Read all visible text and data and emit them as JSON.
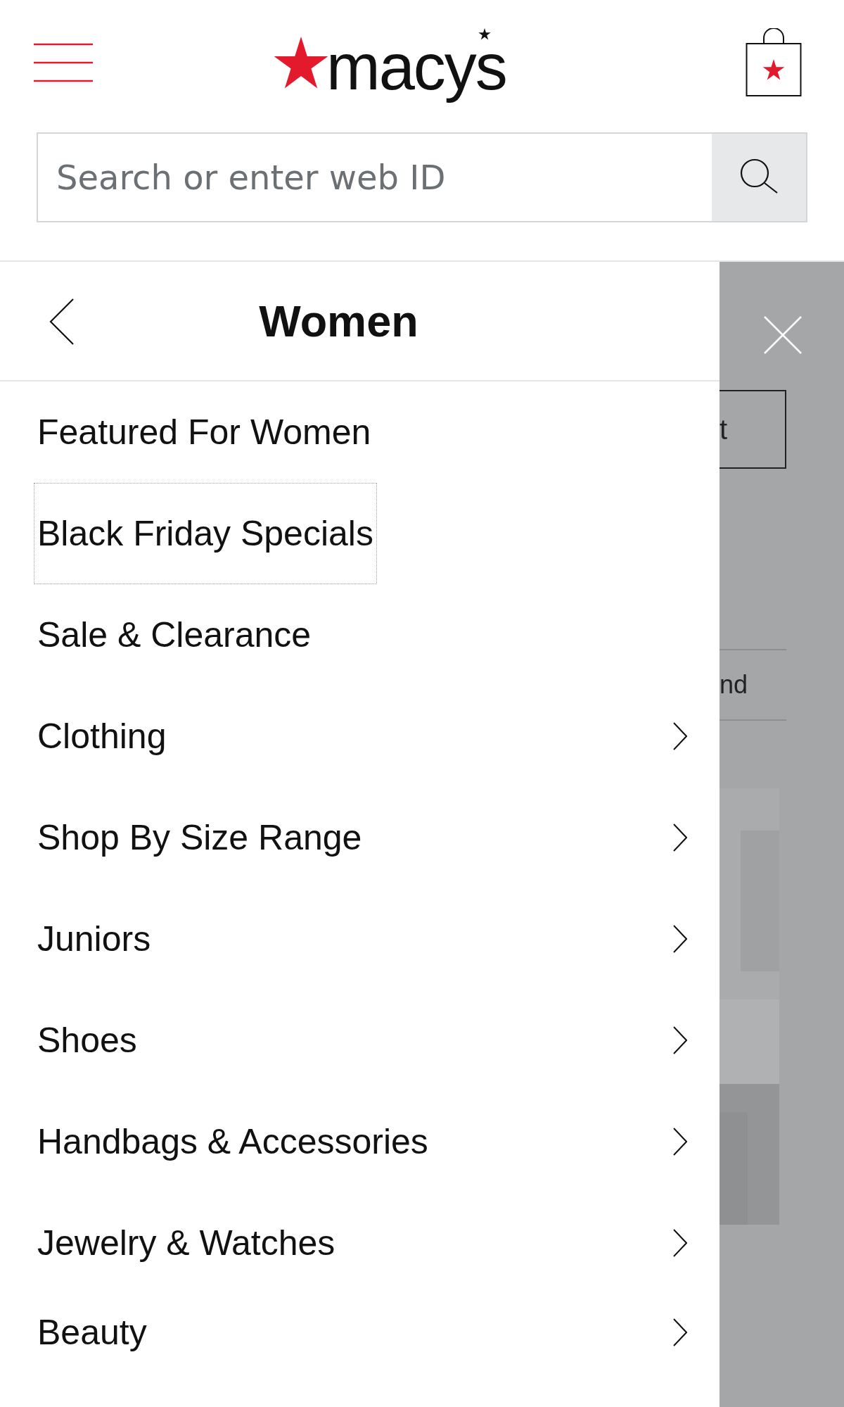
{
  "header": {
    "logo": "macys"
  },
  "search": {
    "placeholder": "Search or enter web ID"
  },
  "drawer": {
    "title": "Women",
    "items": [
      {
        "label": "Featured For Women",
        "has_children": false,
        "focused": false
      },
      {
        "label": "Black Friday Specials",
        "has_children": false,
        "focused": true
      },
      {
        "label": "Sale & Clearance",
        "has_children": false,
        "focused": false
      },
      {
        "label": "Clothing",
        "has_children": true,
        "focused": false
      },
      {
        "label": "Shop By Size Range",
        "has_children": true,
        "focused": false
      },
      {
        "label": "Juniors",
        "has_children": true,
        "focused": false
      },
      {
        "label": "Shoes",
        "has_children": true,
        "focused": false
      },
      {
        "label": "Handbags & Accessories",
        "has_children": true,
        "focused": false
      },
      {
        "label": "Jewelry & Watches",
        "has_children": true,
        "focused": false
      },
      {
        "label": "Beauty",
        "has_children": true,
        "focused": false
      }
    ]
  },
  "background_page": {
    "button_fragment": "t",
    "text_fragment": "nd"
  }
}
